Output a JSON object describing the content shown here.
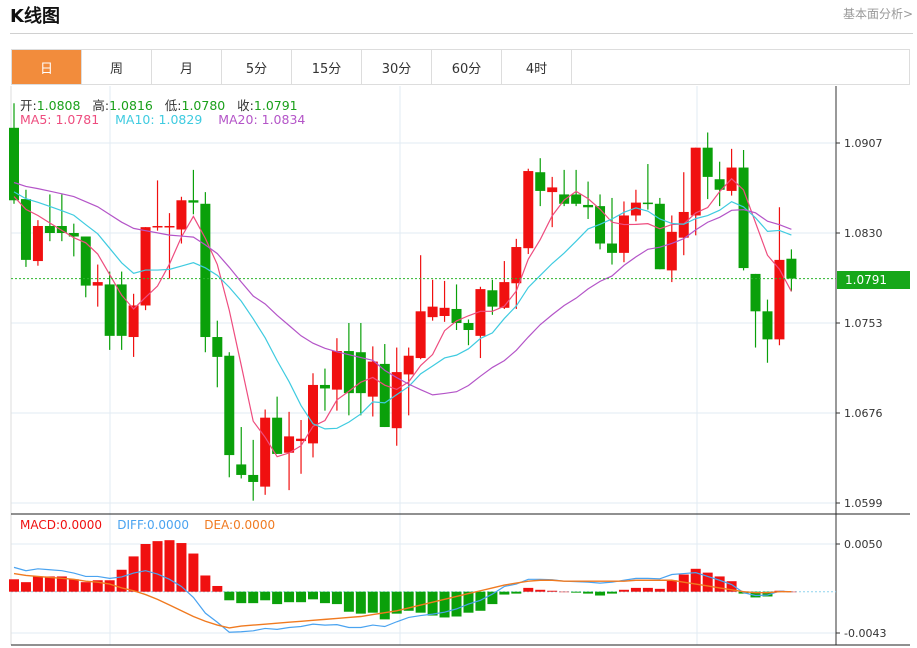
{
  "header": {
    "title": "K线图",
    "fundamental_link": "基本面分析>"
  },
  "tabs": [
    {
      "label": "日",
      "active": true
    },
    {
      "label": "周"
    },
    {
      "label": "月"
    },
    {
      "label": "5分"
    },
    {
      "label": "15分"
    },
    {
      "label": "30分"
    },
    {
      "label": "60分"
    },
    {
      "label": "4时"
    }
  ],
  "ohlc_info": {
    "open_label": "开:",
    "open": "1.0808",
    "high_label": "高:",
    "high": "1.0816",
    "low_label": "低:",
    "low": "1.0780",
    "close_label": "收:",
    "close": "1.0791"
  },
  "ma_info": {
    "ma5": "MA5: 1.0781",
    "ma10": "MA10: 1.0829",
    "ma20": "MA20: 1.0834"
  },
  "macd_info": {
    "macd": "MACD:0.0000",
    "diff": "DIFF:0.0000",
    "dea": "DEA:0.0000"
  },
  "current_price": "1.0791",
  "colors": {
    "up": "#f01010",
    "down": "#0aa00a",
    "ma5": "#ee4d7f",
    "ma10": "#3fcbe0",
    "ma20": "#b455c8",
    "diff": "#4aa3f0",
    "dea": "#f07a20",
    "accent": "#f28c3c"
  },
  "chart_data": {
    "type": "candlestick",
    "price_axis": {
      "ticks": [
        "1.0907",
        "1.0830",
        "1.0753",
        "1.0676",
        "1.0599"
      ],
      "range": [
        1.0599,
        1.0907
      ]
    },
    "macd_axis": {
      "ticks": [
        "0.0050",
        "-0.0043"
      ],
      "range": [
        -0.0043,
        0.005
      ]
    },
    "candles": [
      [
        1.092,
        1.0941,
        1.0855,
        1.0858
      ],
      [
        1.0859,
        1.0867,
        1.0801,
        1.0807
      ],
      [
        1.0806,
        1.0841,
        1.0802,
        1.0836
      ],
      [
        1.0836,
        1.0863,
        1.0823,
        1.083
      ],
      [
        1.0836,
        1.0863,
        1.0823,
        1.083
      ],
      [
        1.083,
        1.0838,
        1.081,
        1.0827
      ],
      [
        1.0827,
        1.0827,
        1.0775,
        1.0785
      ],
      [
        1.0785,
        1.0803,
        1.0767,
        1.0788
      ],
      [
        1.0786,
        1.0797,
        1.073,
        1.0742
      ],
      [
        1.0786,
        1.0797,
        1.073,
        1.0742
      ],
      [
        1.0741,
        1.0778,
        1.0724,
        1.0768
      ],
      [
        1.0768,
        1.0835,
        1.0764,
        1.0835
      ],
      [
        1.0835,
        1.0875,
        1.0832,
        1.0836
      ],
      [
        1.0835,
        1.0847,
        1.0791,
        1.0836
      ],
      [
        1.0833,
        1.0861,
        1.0821,
        1.0858
      ],
      [
        1.0858,
        1.0884,
        1.0846,
        1.0856
      ],
      [
        1.0855,
        1.0865,
        1.0728,
        1.0741
      ],
      [
        1.0741,
        1.0755,
        1.0698,
        1.0724
      ],
      [
        1.0725,
        1.0728,
        1.0621,
        1.064
      ],
      [
        1.0632,
        1.0664,
        1.062,
        1.0623
      ],
      [
        1.0623,
        1.0653,
        1.0601,
        1.0617
      ],
      [
        1.0613,
        1.0679,
        1.0606,
        1.0672
      ],
      [
        1.0672,
        1.069,
        1.0641,
        1.0641
      ],
      [
        1.0642,
        1.0677,
        1.061,
        1.0656
      ],
      [
        1.0652,
        1.067,
        1.0624,
        1.0654
      ],
      [
        1.065,
        1.071,
        1.0638,
        1.07
      ],
      [
        1.07,
        1.0714,
        1.0678,
        1.0697
      ],
      [
        1.0696,
        1.074,
        1.0678,
        1.0729
      ],
      [
        1.0729,
        1.0753,
        1.0674,
        1.0693
      ],
      [
        1.0728,
        1.0753,
        1.0674,
        1.0693
      ],
      [
        1.069,
        1.0733,
        1.0673,
        1.072
      ],
      [
        1.0718,
        1.0735,
        1.0664,
        1.0664
      ],
      [
        1.0663,
        1.0732,
        1.0648,
        1.0711
      ],
      [
        1.0709,
        1.0732,
        1.0674,
        1.0725
      ],
      [
        1.0723,
        1.0811,
        1.0722,
        1.0763
      ],
      [
        1.0758,
        1.079,
        1.0755,
        1.0767
      ],
      [
        1.0759,
        1.0789,
        1.0754,
        1.0766
      ],
      [
        1.0765,
        1.0786,
        1.0747,
        1.0753
      ],
      [
        1.0753,
        1.0756,
        1.0734,
        1.0747
      ],
      [
        1.0742,
        1.0784,
        1.0723,
        1.0782
      ],
      [
        1.0781,
        1.079,
        1.076,
        1.0767
      ],
      [
        1.0766,
        1.0806,
        1.0765,
        1.0788
      ],
      [
        1.0787,
        1.0825,
        1.0765,
        1.0818
      ],
      [
        1.0817,
        1.0885,
        1.0812,
        1.0883
      ],
      [
        1.0882,
        1.0894,
        1.0853,
        1.0866
      ],
      [
        1.0865,
        1.0878,
        1.0835,
        1.0869
      ],
      [
        1.0863,
        1.0884,
        1.0853,
        1.0855
      ],
      [
        1.0863,
        1.0884,
        1.0853,
        1.0855
      ],
      [
        1.0854,
        1.0874,
        1.0842,
        1.0852
      ],
      [
        1.0853,
        1.0863,
        1.0816,
        1.0821
      ],
      [
        1.0821,
        1.086,
        1.0803,
        1.0813
      ],
      [
        1.0813,
        1.0857,
        1.0805,
        1.0845
      ],
      [
        1.0845,
        1.0867,
        1.084,
        1.0856
      ],
      [
        1.0856,
        1.0889,
        1.085,
        1.0855
      ],
      [
        1.0855,
        1.086,
        1.0799,
        1.0799
      ],
      [
        1.0798,
        1.0845,
        1.0788,
        1.0831
      ],
      [
        1.0826,
        1.0882,
        1.0811,
        1.0848
      ],
      [
        1.0845,
        1.0903,
        1.0828,
        1.0903
      ],
      [
        1.0903,
        1.0916,
        1.0859,
        1.0878
      ],
      [
        1.0876,
        1.0891,
        1.0853,
        1.0867
      ],
      [
        1.0866,
        1.0902,
        1.0862,
        1.0886
      ],
      [
        1.0886,
        1.0901,
        1.0798,
        1.08
      ],
      [
        1.0795,
        1.0795,
        1.0732,
        1.0763
      ],
      [
        1.0763,
        1.0773,
        1.0719,
        1.0739
      ],
      [
        1.0739,
        1.0852,
        1.0734,
        1.0807
      ],
      [
        1.0808,
        1.0816,
        1.078,
        1.0791
      ]
    ],
    "macd": [
      0.0013,
      0.001,
      0.0016,
      0.0016,
      0.0016,
      0.0013,
      0.001,
      0.0012,
      0.0012,
      0.0023,
      0.0037,
      0.005,
      0.0053,
      0.0054,
      0.0051,
      0.004,
      0.0017,
      0.0006,
      -0.0009,
      -0.0012,
      -0.0012,
      -0.0009,
      -0.0013,
      -0.0011,
      -0.0011,
      -0.0008,
      -0.0012,
      -0.0013,
      -0.0021,
      -0.0023,
      -0.0022,
      -0.0029,
      -0.0023,
      -0.002,
      -0.0022,
      -0.0025,
      -0.0027,
      -0.0026,
      -0.0022,
      -0.002,
      -0.0013,
      -0.0003,
      -0.0002,
      0.0004,
      0.0002,
      0.0001,
      0.0,
      -0.0001,
      -0.0002,
      -0.0004,
      -0.0002,
      0.0002,
      0.0004,
      0.0004,
      0.0003,
      0.0012,
      0.0018,
      0.0024,
      0.002,
      0.0016,
      0.0011,
      -0.0002,
      -0.0006,
      -0.0005,
      0.0001,
      0.0
    ],
    "dea": [
      0.0019,
      0.0017,
      0.0016,
      0.0015,
      0.0014,
      0.0013,
      0.0011,
      0.001,
      0.0008,
      0.0004,
      0.0001,
      -0.0003,
      -0.0008,
      -0.0014,
      -0.002,
      -0.0026,
      -0.0031,
      -0.0035,
      -0.0038,
      -0.0036,
      -0.0035,
      -0.0034,
      -0.0033,
      -0.0032,
      -0.0031,
      -0.003,
      -0.0029,
      -0.0028,
      -0.0027,
      -0.0026,
      -0.0024,
      -0.0022,
      -0.002,
      -0.0017,
      -0.0014,
      -0.0011,
      -0.0008,
      -0.0005,
      -0.0002,
      0.0001,
      0.0004,
      0.0007,
      0.0009,
      0.0011,
      0.0012,
      0.0012,
      0.0011,
      0.0011,
      0.0011,
      0.0011,
      0.0011,
      0.0011,
      0.0012,
      0.0012,
      0.0012,
      0.0012,
      0.001,
      0.0008,
      0.0006,
      0.0004,
      0.0002,
      0.0,
      -0.0001,
      -0.0001,
      0.0,
      0.0
    ]
  }
}
